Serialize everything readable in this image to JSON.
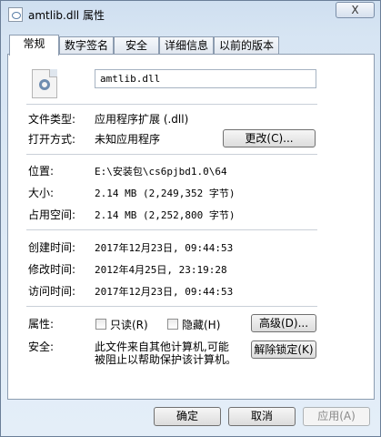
{
  "window": {
    "title": "amtlib.dll 属性",
    "close_label": "X"
  },
  "tabs": [
    {
      "label": "常规",
      "active": true
    },
    {
      "label": "数字签名",
      "active": false
    },
    {
      "label": "安全",
      "active": false
    },
    {
      "label": "详细信息",
      "active": false
    },
    {
      "label": "以前的版本",
      "active": false
    }
  ],
  "general": {
    "file_name": "amtlib.dll",
    "file_type_label": "文件类型:",
    "file_type_value": "应用程序扩展 (.dll)",
    "open_with_label": "打开方式:",
    "open_with_value": "未知应用程序",
    "change_button": "更改(C)...",
    "location_label": "位置:",
    "location_value": "E:\\安装包\\cs6pjbd1.0\\64",
    "size_label": "大小:",
    "size_value": "2.14 MB (2,249,352 字节)",
    "size_on_disk_label": "占用空间:",
    "size_on_disk_value": "2.14 MB (2,252,800 字节)",
    "created_label": "创建时间:",
    "created_value": "2017年12月23日, 09:44:53",
    "modified_label": "修改时间:",
    "modified_value": "2012年4月25日, 23:19:28",
    "accessed_label": "访问时间:",
    "accessed_value": "2017年12月23日, 09:44:53",
    "attributes_label": "属性:",
    "readonly_label": "只读(R)",
    "hidden_label": "隐藏(H)",
    "advanced_button": "高级(D)...",
    "security_label": "安全:",
    "security_text_line1": "此文件来自其他计算机,可能",
    "security_text_line2": "被阻止以帮助保护该计算机。",
    "unblock_button": "解除锁定(K)"
  },
  "footer": {
    "ok": "确定",
    "cancel": "取消",
    "apply": "应用(A)"
  }
}
